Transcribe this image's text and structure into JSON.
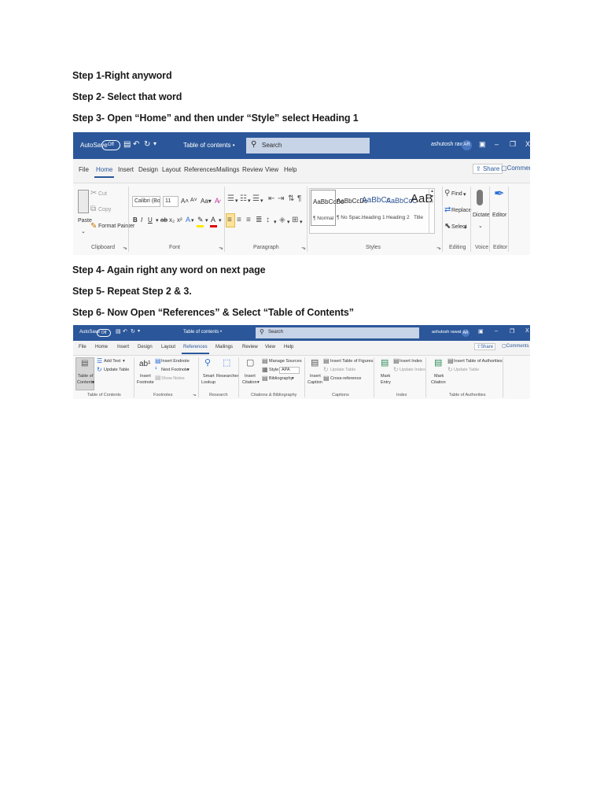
{
  "steps": {
    "s1": "Step 1-Right anyword",
    "s2": "Step 2- Select that word",
    "s3": "Step 3- Open “Home” and then under “Style” select Heading 1",
    "s4": "Step 4- Again right any word on next page",
    "s5": "Step 5- Repeat Step 2 & 3.",
    "s6": "Step 6- Now Open “References” & Select “Table of Contents”"
  },
  "screenshot1": {
    "titlebar": {
      "autosave": "AutoSave",
      "toggle": "Off",
      "doc_title": "Table of contents •",
      "search": "Search",
      "user": "ashutosh rawat",
      "initials": "AR"
    },
    "tabs": [
      "File",
      "Home",
      "Insert",
      "Design",
      "Layout",
      "References",
      "Mailings",
      "Review",
      "View",
      "Help"
    ],
    "active_tab": "Home",
    "share": "Share",
    "comments": "Comments",
    "clipboard": {
      "paste": "Paste",
      "cut": "Cut",
      "copy": "Copy",
      "format_painter": "Format Painter",
      "label": "Clipboard"
    },
    "font": {
      "name": "Calibri (Body)",
      "size": "11",
      "label": "Font"
    },
    "paragraph": {
      "label": "Paragraph"
    },
    "styles": {
      "items": [
        {
          "sample": "AaBbCcDc",
          "name": "¶ Normal"
        },
        {
          "sample": "AaBbCcDc",
          "name": "¶ No Spac..."
        },
        {
          "sample": "AaBbCc",
          "name": "Heading 1"
        },
        {
          "sample": "AaBbCcC",
          "name": "Heading 2"
        },
        {
          "sample": "AaB",
          "name": "Title"
        }
      ],
      "label": "Styles"
    },
    "editing": {
      "find": "Find",
      "replace": "Replace",
      "select": "Select",
      "label": "Editing"
    },
    "voice": {
      "dictate": "Dictate",
      "label": "Voice"
    },
    "editor": {
      "button": "Editor",
      "label": "Editor"
    },
    "colors": {
      "titlebar": "#2b579a",
      "highlight": "#ffe800",
      "font_color": "#e00000"
    }
  },
  "screenshot2": {
    "titlebar": {
      "autosave": "AutoSave",
      "toggle": "Off",
      "doc_title": "Table of contents •",
      "search": "Search",
      "user": "ashutosh rawat",
      "initials": "AR"
    },
    "tabs": [
      "File",
      "Home",
      "Insert",
      "Design",
      "Layout",
      "References",
      "Mailings",
      "Review",
      "View",
      "Help"
    ],
    "active_tab": "References",
    "share": "Share",
    "comments": "Comments",
    "toc": {
      "button_line1": "Table of",
      "button_line2": "Contents",
      "add_text": "Add Text",
      "update_table": "Update Table",
      "label": "Table of Contents"
    },
    "footnotes": {
      "insert_endnote": "Insert Endnote",
      "next_footnote": "Next Footnote",
      "show_notes": "Show Notes",
      "insert_line1": "Insert",
      "insert_line2": "Footnote",
      "label": "Footnotes"
    },
    "research": {
      "smart_line1": "Smart",
      "smart_line2": "Lookup",
      "researcher": "Researcher",
      "label": "Research"
    },
    "citations": {
      "insert_line1": "Insert",
      "insert_line2": "Citation",
      "manage_sources": "Manage Sources",
      "style": "Style:",
      "style_value": "APA",
      "bibliography": "Bibliography",
      "label": "Citations & Bibliography"
    },
    "captions": {
      "insert_line1": "Insert",
      "insert_line2": "Caption",
      "insert_tof": "Insert Table of Figures",
      "update_table": "Update Table",
      "cross_reference": "Cross-reference",
      "label": "Captions"
    },
    "index": {
      "mark_line1": "Mark",
      "mark_line2": "Entry",
      "insert_index": "Insert Index",
      "update_index": "Update Index",
      "label": "Index"
    },
    "authorities": {
      "mark_line1": "Mark",
      "mark_line2": "Citation",
      "insert_toa": "Insert Table of Authorities",
      "update_table": "Update Table",
      "label": "Table of Authorities"
    }
  }
}
